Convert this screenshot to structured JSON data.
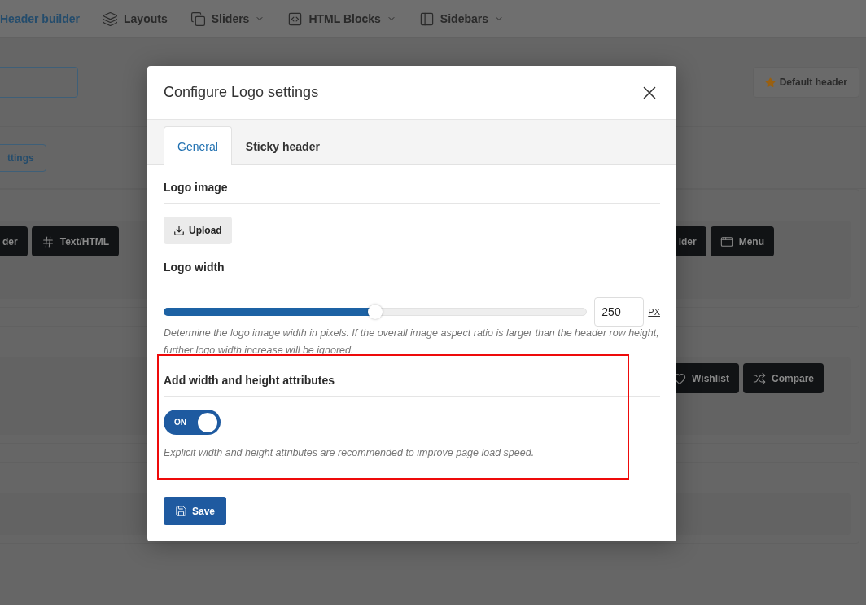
{
  "nav": [
    {
      "label": "Header builder",
      "selected": true,
      "kind": "none",
      "dropdown": false
    },
    {
      "label": "Layouts",
      "selected": false,
      "kind": "layers",
      "dropdown": false
    },
    {
      "label": "Sliders",
      "selected": false,
      "kind": "slides",
      "dropdown": true
    },
    {
      "label": "HTML Blocks",
      "selected": false,
      "kind": "code",
      "dropdown": true
    },
    {
      "label": "Sidebars",
      "selected": false,
      "kind": "sidebar",
      "dropdown": true
    }
  ],
  "background": {
    "settings_button": "ttings",
    "default_header": "Default header",
    "panels": [
      {
        "left": [
          {
            "label": "der",
            "kind": "plain"
          },
          {
            "label": "Text/HTML",
            "kind": "html"
          }
        ],
        "right": [
          {
            "label": "ider",
            "kind": "plain"
          },
          {
            "label": "Menu",
            "kind": "menu"
          }
        ]
      },
      {
        "right": [
          {
            "label": "Wishlist",
            "kind": "wishlist"
          },
          {
            "label": "Compare",
            "kind": "compare"
          }
        ]
      }
    ]
  },
  "dialog": {
    "title": "Configure Logo settings",
    "tabs": [
      {
        "label": "General",
        "selected": true
      },
      {
        "label": "Sticky header",
        "selected": false
      }
    ],
    "sections": [
      {
        "kind": "upload",
        "title": "Logo image",
        "button": "Upload",
        "highlighted": false
      },
      {
        "kind": "slider",
        "title": "Logo width",
        "level": 0.5,
        "value": "250",
        "unit": "PX",
        "help": "Determine the logo image width in pixels. If the overall image aspect ratio is larger than the header row height, further logo width increase will be ignored.",
        "highlighted": false
      },
      {
        "kind": "toggle",
        "title": "Add width and height attributes",
        "on": true,
        "state_label": "ON",
        "help": "Explicit width and height attributes are recommended to improve page load speed.",
        "highlighted": true
      }
    ],
    "save": "Save"
  }
}
